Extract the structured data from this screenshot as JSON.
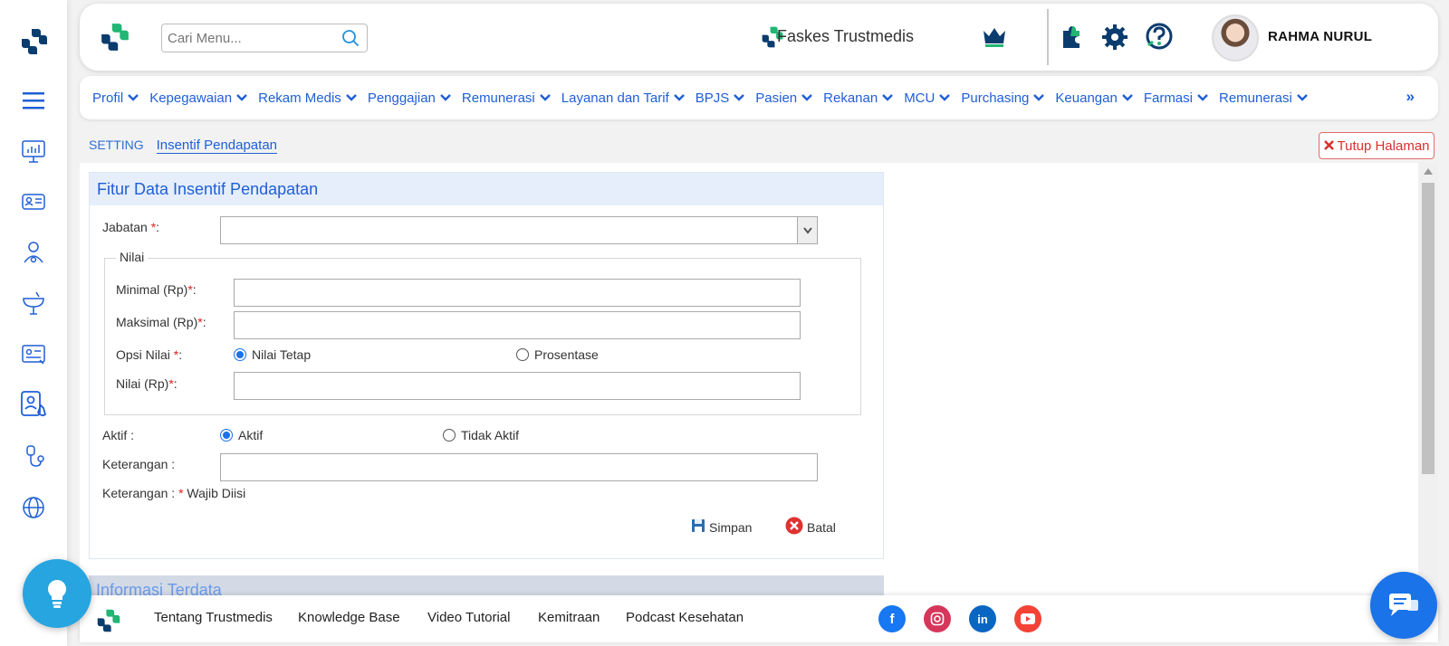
{
  "header": {
    "search_placeholder": "Cari Menu...",
    "facility_name": "Faskes Trustmedis",
    "user_name": "RAHMA NURUL"
  },
  "menu": {
    "items": [
      {
        "label": "Profil"
      },
      {
        "label": "Kepegawaian"
      },
      {
        "label": "Rekam Medis"
      },
      {
        "label": "Penggajian"
      },
      {
        "label": "Remunerasi"
      },
      {
        "label": "Layanan dan Tarif"
      },
      {
        "label": "BPJS"
      },
      {
        "label": "Pasien"
      },
      {
        "label": "Rekanan"
      },
      {
        "label": "MCU"
      },
      {
        "label": "Purchasing"
      },
      {
        "label": "Keuangan"
      },
      {
        "label": "Farmasi"
      },
      {
        "label": "Remunerasi"
      }
    ],
    "more": "»"
  },
  "breadcrumb": {
    "section": "SETTING",
    "page": "Insentif Pendapatan"
  },
  "close_page_label": "Tutup Halaman",
  "form": {
    "title": "Fitur Data Insentif Pendapatan",
    "jabatan_label": "Jabatan ",
    "jabatan_value": "",
    "nilai_legend": "Nilai",
    "minimal_label": "Minimal (Rp)",
    "maksimal_label": "Maksimal (Rp)",
    "opsi_label": "Opsi Nilai ",
    "opsi_options": [
      "Nilai Tetap",
      "Prosentase"
    ],
    "opsi_selected": "Nilai Tetap",
    "nilai_label": "Nilai (Rp)",
    "aktif_label": "Aktif :",
    "aktif_options": [
      "Aktif",
      "Tidak Aktif"
    ],
    "aktif_selected": "Aktif",
    "keterangan_label": "Keterangan :",
    "note_prefix": "Keterangan : ",
    "note_star": "*",
    "note_text": " Wajib Diisi",
    "save_label": "Simpan",
    "cancel_label": "Batal"
  },
  "info_section_title": "Informasi Terdata",
  "footer": {
    "links": [
      "Tentang Trustmedis",
      "Knowledge Base",
      "Video Tutorial",
      "Kemitraan",
      "Podcast Kesehatan"
    ]
  },
  "colors": {
    "brand_blue": "#1f5fd6",
    "brand_green": "#22b573",
    "navy": "#0b3c6e",
    "required": "#e02020"
  }
}
